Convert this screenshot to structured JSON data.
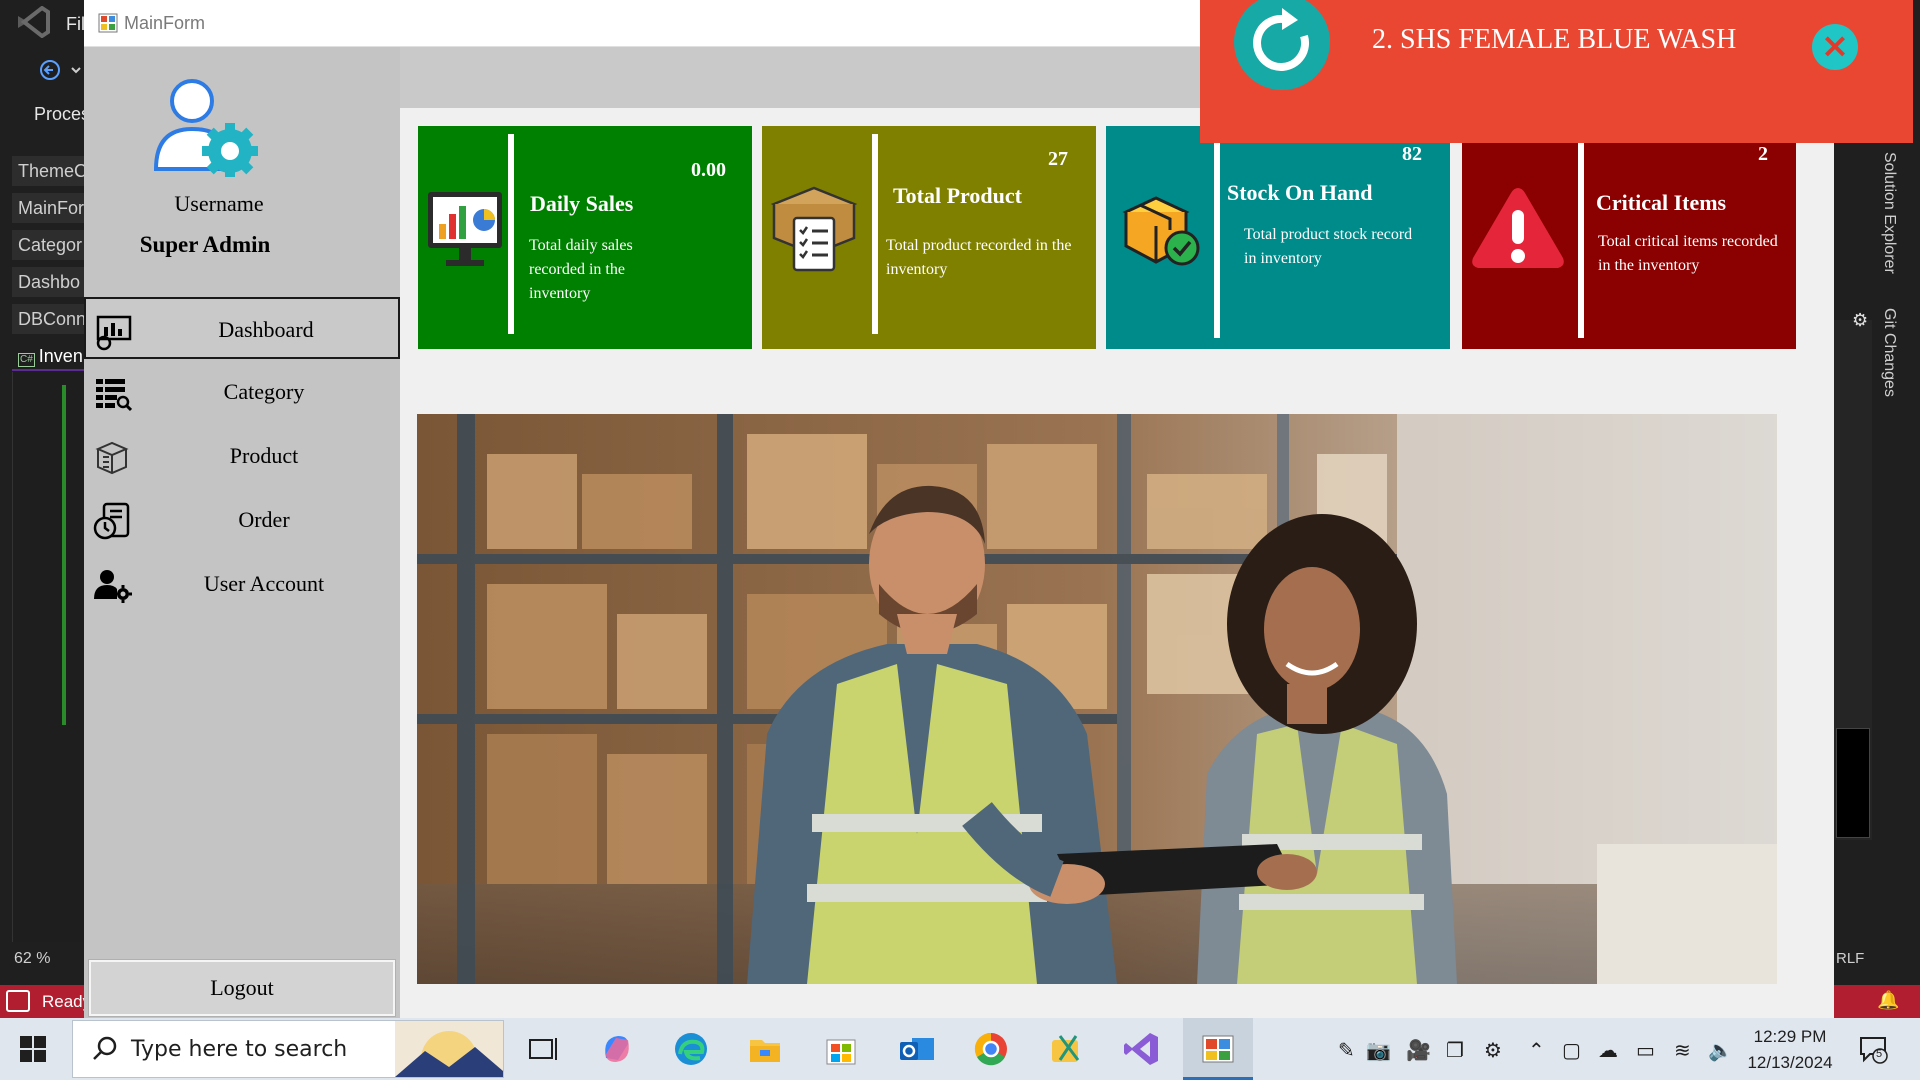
{
  "vs": {
    "menu": "Fil",
    "process": "Proces",
    "tabs": [
      "ThemeC",
      "MainFor",
      "Categor",
      "Dashbo",
      "DBConn",
      "Inven"
    ],
    "zoom": "62 %",
    "status": "Ready",
    "crlf": "RLF",
    "solution_explorer": "Solution Explorer",
    "git_changes": "Git Changes"
  },
  "window": {
    "title": "MainForm"
  },
  "sidebar": {
    "username_label": "Username",
    "username_value": "Super Admin",
    "items": [
      {
        "label": "Dashboard",
        "icon": "dashboard-icon",
        "active": true
      },
      {
        "label": "Category",
        "icon": "category-list-icon",
        "active": false
      },
      {
        "label": "Product",
        "icon": "product-box-icon",
        "active": false
      },
      {
        "label": "Order",
        "icon": "order-clock-icon",
        "active": false
      },
      {
        "label": "User Account",
        "icon": "user-gear-icon",
        "active": false
      }
    ],
    "logout": "Logout"
  },
  "cards": [
    {
      "value": "0.00",
      "title": "Daily Sales",
      "desc": "Total daily sales recorded in the inventory",
      "color": "#008000",
      "icon": "sales-monitor-icon"
    },
    {
      "value": "27",
      "title": "Total Product",
      "desc": "Total product recorded in the inventory",
      "color": "#808000",
      "icon": "product-checklist-icon"
    },
    {
      "value": "82",
      "title": "Stock On Hand",
      "desc": "Total product stock record in inventory",
      "color": "#008b8b",
      "icon": "stock-box-check-icon"
    },
    {
      "value": "2",
      "title": "Critical Items",
      "desc": "Total critical items recorded in the inventory",
      "color": "#8b0000",
      "icon": "warning-triangle-icon"
    }
  ],
  "notification": {
    "text": "2. SHS FEMALE BLUE WASH",
    "icon": "refresh-icon",
    "color": "#ea4733"
  },
  "taskbar": {
    "search_placeholder": "Type here to search",
    "time": "12:29 PM",
    "date": "12/13/2024",
    "notification_count": "5"
  }
}
